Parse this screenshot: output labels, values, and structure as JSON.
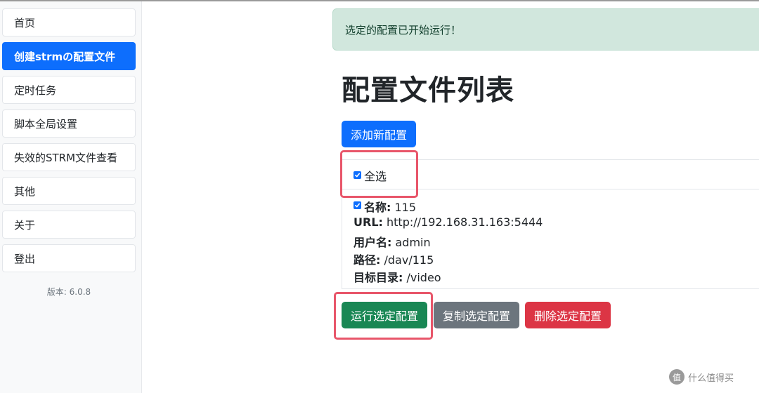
{
  "sidebar": {
    "items": [
      {
        "label": "首页",
        "active": false
      },
      {
        "label": "创建strmの配置文件",
        "active": true
      },
      {
        "label": "定时任务",
        "active": false
      },
      {
        "label": "脚本全局设置",
        "active": false
      },
      {
        "label": "失效的STRM文件查看",
        "active": false
      },
      {
        "label": "其他",
        "active": false
      },
      {
        "label": "关于",
        "active": false
      },
      {
        "label": "登出",
        "active": false
      }
    ],
    "version": "版本: 6.0.8"
  },
  "alert": {
    "message": "选定的配置已开始运行！"
  },
  "main": {
    "title": "配置文件列表",
    "add_button": "添加新配置",
    "select_all": {
      "label": "全选",
      "checked": true
    },
    "config": {
      "checked": true,
      "name_label": "名称:",
      "name_value": "115",
      "url_label": "URL:",
      "url_value": "http://192.168.31.163:5444",
      "user_label": "用户名:",
      "user_value": "admin",
      "path_label": "路径:",
      "path_value": "/dav/115",
      "target_label": "目标目录:",
      "target_value": "/video"
    },
    "actions": {
      "run": "运行选定配置",
      "copy": "复制选定配置",
      "delete": "删除选定配置"
    }
  },
  "watermark": {
    "badge": "值",
    "text": "什么值得买"
  },
  "colors": {
    "primary": "#0d6efd",
    "success": "#198754",
    "secondary": "#6c757d",
    "danger": "#dc3545",
    "alert_bg": "#d1e7dd",
    "highlight": "#e8566a"
  }
}
